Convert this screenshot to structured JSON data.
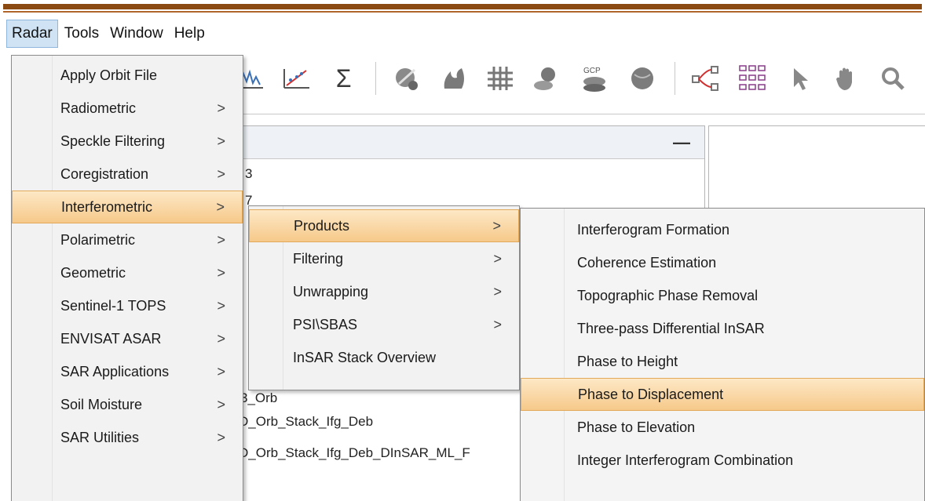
{
  "menubar": {
    "items": [
      {
        "label": "Radar",
        "active": true
      },
      {
        "label": "Tools",
        "active": false
      },
      {
        "label": "Window",
        "active": false
      },
      {
        "label": "Help",
        "active": false
      }
    ]
  },
  "toolbar": {
    "icons": [
      "histogram-icon",
      "scatter-plot-icon",
      "sigma-statistics-icon",
      "layer-icon",
      "fire-icon",
      "grid-icon",
      "mask-icon",
      "gcp-icon",
      "globe-icon",
      "graph-builder-icon",
      "batch-processing-icon",
      "pointer-icon",
      "pan-hand-icon",
      "zoom-icon"
    ],
    "gcp_label": "GCP"
  },
  "product_pane": {
    "partial_items": [
      "3",
      "7",
      "3_Orb",
      "D_Orb_Stack_Ifg_Deb",
      "D_Orb_Stack_Ifg_Deb_DInSAR_ML_F"
    ],
    "minimize_label": "—"
  },
  "radar_menu": {
    "items": [
      {
        "label": "Apply Orbit File",
        "arrow": ""
      },
      {
        "label": "Radiometric",
        "arrow": ">"
      },
      {
        "label": "Speckle Filtering",
        "arrow": ">"
      },
      {
        "label": "Coregistration",
        "arrow": ">"
      },
      {
        "label": "Interferometric",
        "arrow": ">",
        "highlighted": true
      },
      {
        "label": "Polarimetric",
        "arrow": ">"
      },
      {
        "label": "Geometric",
        "arrow": ">"
      },
      {
        "label": "Sentinel-1 TOPS",
        "arrow": ">"
      },
      {
        "label": "ENVISAT ASAR",
        "arrow": ">"
      },
      {
        "label": "SAR Applications",
        "arrow": ">"
      },
      {
        "label": "Soil Moisture",
        "arrow": ">"
      },
      {
        "label": "SAR Utilities",
        "arrow": ">"
      }
    ]
  },
  "interferometric_menu": {
    "items": [
      {
        "label": "Products",
        "arrow": ">",
        "highlighted": true
      },
      {
        "label": "Filtering",
        "arrow": ">"
      },
      {
        "label": "Unwrapping",
        "arrow": ">"
      },
      {
        "label": "PSI\\SBAS",
        "arrow": ">"
      },
      {
        "label": "InSAR Stack Overview",
        "arrow": ""
      }
    ]
  },
  "products_menu": {
    "items": [
      {
        "label": "Interferogram Formation"
      },
      {
        "label": "Coherence Estimation"
      },
      {
        "label": "Topographic Phase Removal"
      },
      {
        "label": "Three-pass Differential InSAR"
      },
      {
        "label": "Phase to Height"
      },
      {
        "label": "Phase to Displacement",
        "highlighted": true
      },
      {
        "label": "Phase to Elevation"
      },
      {
        "label": "Integer Interferogram Combination"
      }
    ]
  },
  "colors": {
    "highlight": "#f6c98a",
    "highlight_border": "#e2a95a",
    "top_rule": "#8a4a12",
    "menubar_active": "#cfe3f5"
  }
}
